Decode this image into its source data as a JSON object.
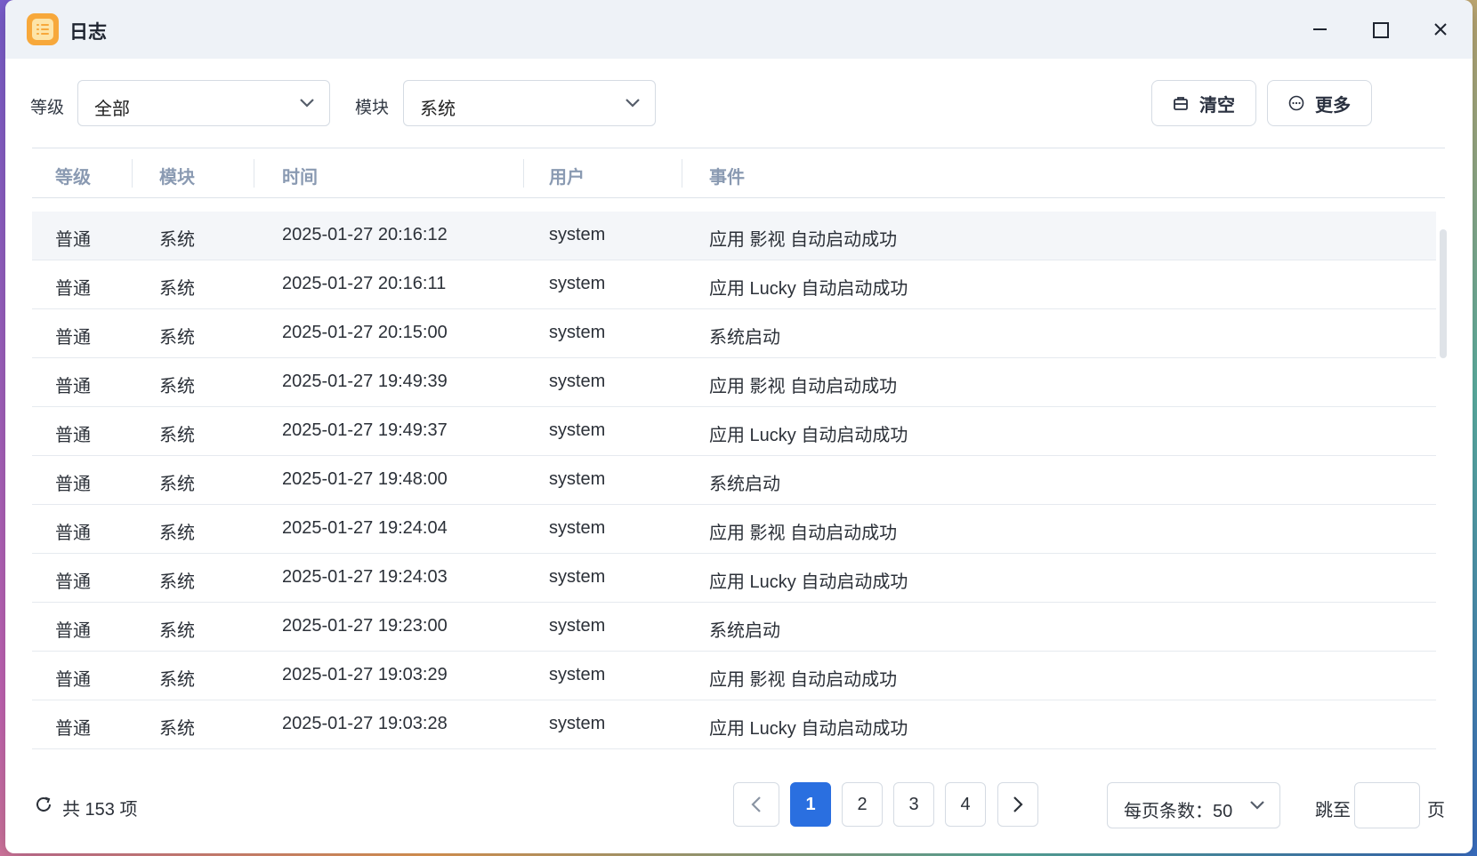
{
  "window": {
    "title": "日志"
  },
  "filters": {
    "level_label": "等级",
    "level_value": "全部",
    "module_label": "模块",
    "module_value": "系统"
  },
  "actions": {
    "clear_label": "清空",
    "more_label": "更多"
  },
  "table": {
    "columns": [
      "等级",
      "模块",
      "时间",
      "用户",
      "事件"
    ],
    "rows": [
      {
        "level": "普通",
        "module": "系统",
        "time": "2025-01-27 20:16:12",
        "user": "system",
        "event": "应用 影视 自动启动成功"
      },
      {
        "level": "普通",
        "module": "系统",
        "time": "2025-01-27 20:16:11",
        "user": "system",
        "event": "应用 Lucky 自动启动成功"
      },
      {
        "level": "普通",
        "module": "系统",
        "time": "2025-01-27 20:15:00",
        "user": "system",
        "event": "系统启动"
      },
      {
        "level": "普通",
        "module": "系统",
        "time": "2025-01-27 19:49:39",
        "user": "system",
        "event": "应用 影视 自动启动成功"
      },
      {
        "level": "普通",
        "module": "系统",
        "time": "2025-01-27 19:49:37",
        "user": "system",
        "event": "应用 Lucky 自动启动成功"
      },
      {
        "level": "普通",
        "module": "系统",
        "time": "2025-01-27 19:48:00",
        "user": "system",
        "event": "系统启动"
      },
      {
        "level": "普通",
        "module": "系统",
        "time": "2025-01-27 19:24:04",
        "user": "system",
        "event": "应用 影视 自动启动成功"
      },
      {
        "level": "普通",
        "module": "系统",
        "time": "2025-01-27 19:24:03",
        "user": "system",
        "event": "应用 Lucky 自动启动成功"
      },
      {
        "level": "普通",
        "module": "系统",
        "time": "2025-01-27 19:23:00",
        "user": "system",
        "event": "系统启动"
      },
      {
        "level": "普通",
        "module": "系统",
        "time": "2025-01-27 19:03:29",
        "user": "system",
        "event": "应用 影视 自动启动成功"
      },
      {
        "level": "普通",
        "module": "系统",
        "time": "2025-01-27 19:03:28",
        "user": "system",
        "event": "应用 Lucky 自动启动成功"
      }
    ]
  },
  "footer": {
    "total_text": "共 153 项",
    "pages": [
      "1",
      "2",
      "3",
      "4"
    ],
    "current_page": "1",
    "page_size_text": "每页条数：50",
    "jump_label": "跳至",
    "jump_value": "",
    "page_suffix": "页"
  },
  "colors": {
    "accent": "#2a6fe0",
    "header_text": "#8a9ab2",
    "titlebar": "#eef2f7",
    "app_icon": "#f7a83b"
  },
  "icons": {
    "app": "notepad-icon",
    "minimize": "minimize-icon",
    "maximize": "maximize-icon",
    "close": "close-icon",
    "chevron": "chevron-down-icon",
    "clear": "briefcase-icon",
    "more": "more-circle-icon",
    "refresh": "refresh-icon",
    "prev": "chevron-left-icon",
    "next": "chevron-right-icon"
  }
}
